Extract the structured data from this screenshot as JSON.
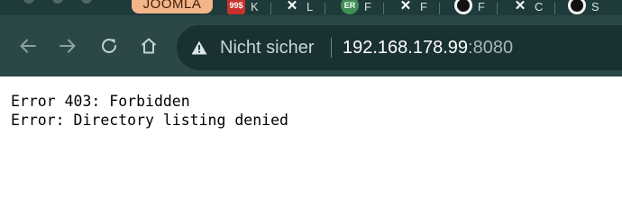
{
  "browser": {
    "tabs": [
      {
        "label": "JOOMLA",
        "active": true,
        "favicon": "none"
      },
      {
        "label": "K",
        "active": false,
        "favicon": "red-badge-icon",
        "favicon_text": "99$"
      },
      {
        "label": "L",
        "active": false,
        "favicon": "crow-icon"
      },
      {
        "label": "F",
        "active": false,
        "favicon": "green-circle-icon",
        "favicon_text": "ER"
      },
      {
        "label": "F",
        "active": false,
        "favicon": "crow-icon"
      },
      {
        "label": "F",
        "active": false,
        "favicon": "ring-icon"
      },
      {
        "label": "C",
        "active": false,
        "favicon": "crow-icon"
      },
      {
        "label": "S",
        "active": false,
        "favicon": "ring-icon"
      }
    ],
    "toolbar": {
      "back_icon": "arrow-left-icon",
      "forward_icon": "arrow-right-icon",
      "reload_icon": "reload-icon",
      "home_icon": "home-icon"
    },
    "address_bar": {
      "security_icon": "warning-triangle-icon",
      "security_label": "Nicht sicher",
      "url_host": "192.168.178.99",
      "url_port": ":8080"
    },
    "colors": {
      "tabstrip_bg": "#1f3a3a",
      "toolbar_bg": "#2b4748",
      "omnibox_bg": "#193132",
      "active_tab_bg": "#f3b58a"
    }
  },
  "page": {
    "lines": [
      "Error 403: Forbidden",
      "Error: Directory listing denied"
    ]
  }
}
